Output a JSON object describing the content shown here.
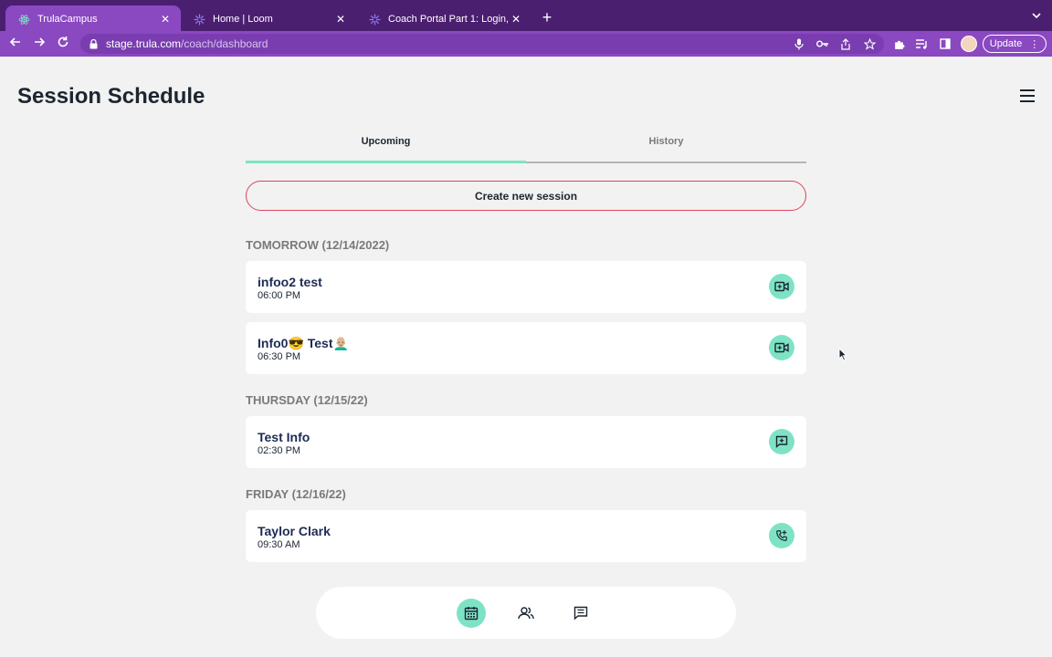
{
  "browser": {
    "tabs": [
      {
        "title": "TrulaCampus",
        "active": true
      },
      {
        "title": "Home | Loom",
        "active": false
      },
      {
        "title": "Coach Portal Part 1: Login, Orie",
        "active": false
      }
    ],
    "url_host": "stage.trula.com",
    "url_path": "/coach/dashboard",
    "update_label": "Update"
  },
  "header": {
    "title": "Session Schedule"
  },
  "tabs": {
    "upcoming": "Upcoming",
    "history": "History"
  },
  "create_button": "Create new session",
  "days": [
    {
      "label": "TOMORROW (12/14/2022)",
      "sessions": [
        {
          "name": "infoo2 test",
          "time": "06:00 PM",
          "icon": "video-add-icon"
        },
        {
          "name": "Info0😎 Test👨🏼‍🦲",
          "time": "06:30 PM",
          "icon": "video-add-icon"
        }
      ]
    },
    {
      "label": "THURSDAY (12/15/22)",
      "sessions": [
        {
          "name": "Test Info",
          "time": "02:30 PM",
          "icon": "chat-add-icon"
        }
      ]
    },
    {
      "label": "FRIDAY (12/16/22)",
      "sessions": [
        {
          "name": "Taylor Clark",
          "time": "09:30 AM",
          "icon": "phone-add-icon"
        }
      ]
    }
  ],
  "bottom_nav": [
    "calendar-icon",
    "people-icon",
    "messages-icon"
  ],
  "colors": {
    "accent": "#7ee3c5",
    "brand_purple": "#8a48c1",
    "create_border": "#d9465a",
    "name_text": "#1d2b55"
  }
}
